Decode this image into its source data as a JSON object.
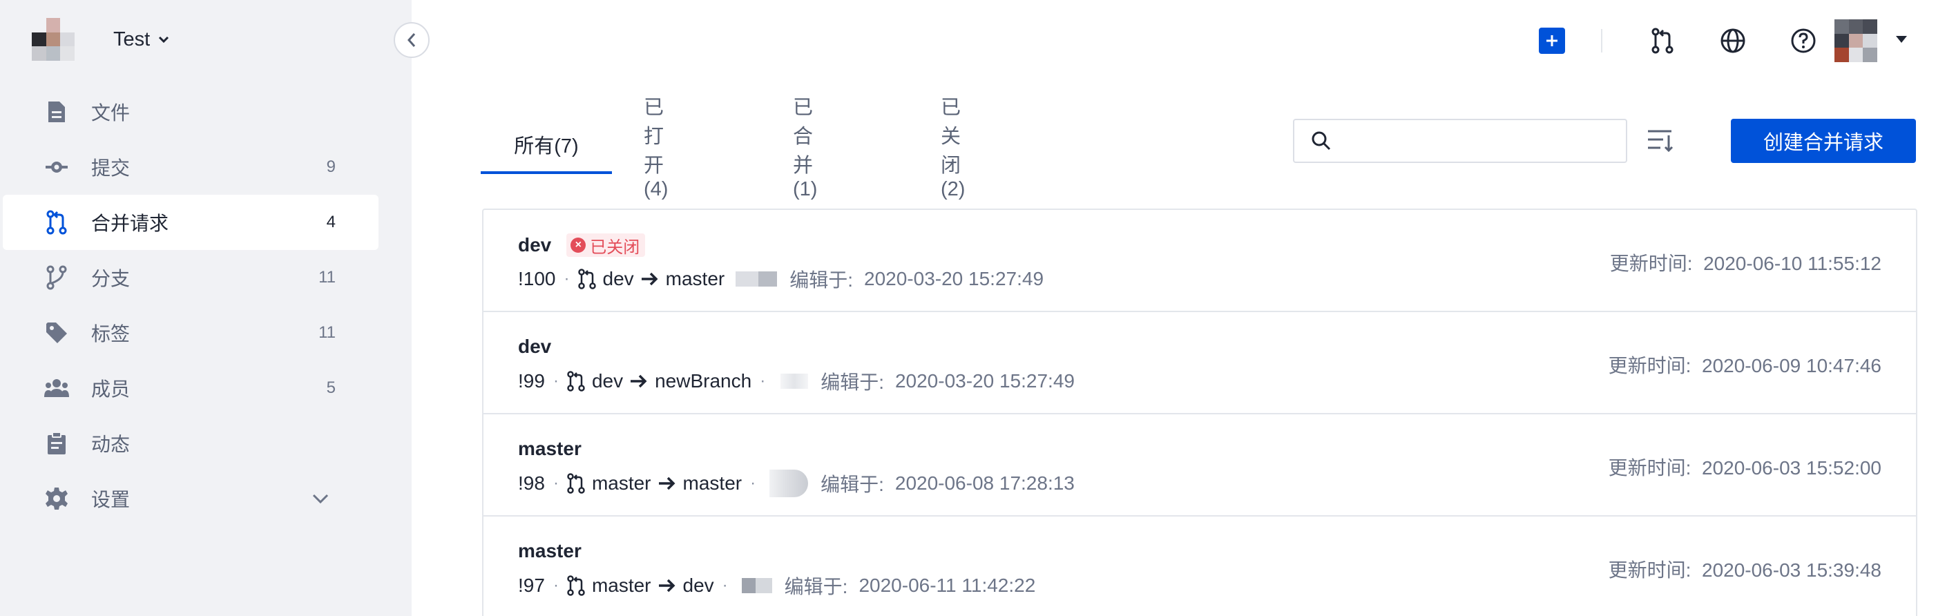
{
  "project": {
    "name": "Test"
  },
  "sidebar": {
    "items": [
      {
        "label": "文件",
        "count": "",
        "icon": "file-icon"
      },
      {
        "label": "提交",
        "count": "9",
        "icon": "commit-icon"
      },
      {
        "label": "合并请求",
        "count": "4",
        "icon": "merge-request-icon",
        "active": true
      },
      {
        "label": "分支",
        "count": "11",
        "icon": "branch-icon"
      },
      {
        "label": "标签",
        "count": "11",
        "icon": "tag-icon"
      },
      {
        "label": "成员",
        "count": "5",
        "icon": "members-icon"
      },
      {
        "label": "动态",
        "count": "",
        "icon": "activity-icon"
      },
      {
        "label": "设置",
        "count": "",
        "icon": "gear-icon"
      }
    ]
  },
  "tabs": [
    "所有(7)",
    "已打开(4)",
    "已合并(1)",
    "已关闭(2)"
  ],
  "search": {
    "placeholder": ""
  },
  "create_button": "创建合并请求",
  "update_label": "更新时间:",
  "edited_label": "编辑于:",
  "merge_requests": [
    {
      "title": "dev",
      "badge": "已关闭",
      "id": "!100",
      "source": "dev",
      "target": "master",
      "edited": "2020-03-20 15:27:49",
      "updated": "2020-06-10 11:55:12"
    },
    {
      "title": "dev",
      "badge": "",
      "id": "!99",
      "source": "dev",
      "target": "newBranch",
      "edited": "2020-03-20 15:27:49",
      "updated": "2020-06-09 10:47:46"
    },
    {
      "title": "master",
      "badge": "",
      "id": "!98",
      "source": "master",
      "target": "master",
      "edited": "2020-06-08 17:28:13",
      "updated": "2020-06-03 15:52:00"
    },
    {
      "title": "master",
      "badge": "",
      "id": "!97",
      "source": "master",
      "target": "dev",
      "edited": "2020-06-11 11:42:22",
      "updated": "2020-06-03 15:39:48"
    }
  ],
  "colors": {
    "accent": "#0052d9",
    "closed": "#e34d59",
    "sidebar_bg": "#f1f2f5"
  }
}
